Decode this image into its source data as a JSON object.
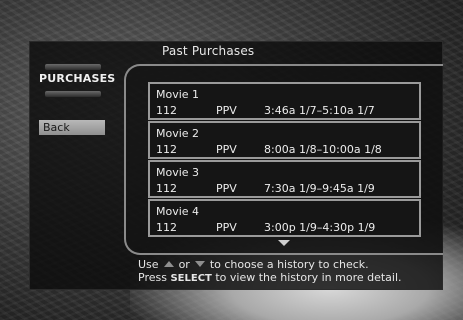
{
  "screen": {
    "title": "Past Purchases",
    "logo_text": "PURCHASES",
    "back_label": "Back"
  },
  "purchases": [
    {
      "name": "Movie 1",
      "channel": "112",
      "type": "PPV",
      "time": "3:46a 1/7–5:10a 1/7"
    },
    {
      "name": "Movie 2",
      "channel": "112",
      "type": "PPV",
      "time": "8:00a 1/8–10:00a 1/8"
    },
    {
      "name": "Movie 3",
      "channel": "112",
      "type": "PPV",
      "time": "7:30a 1/9–9:45a 1/9"
    },
    {
      "name": "Movie 4",
      "channel": "112",
      "type": "PPV",
      "time": "3:00p 1/9–4:30p 1/9"
    }
  ],
  "help": {
    "line1_use": "Use",
    "line1_or": "or",
    "line1_rest": "to choose a history to check.",
    "line2_press": "Press",
    "line2_key": "SELECT",
    "line2_rest": "to view the history in more detail."
  },
  "icons": {
    "scroll_down": "triangle-down-icon",
    "up_arrow": "triangle-up-icon",
    "down_arrow": "triangle-down-icon"
  }
}
